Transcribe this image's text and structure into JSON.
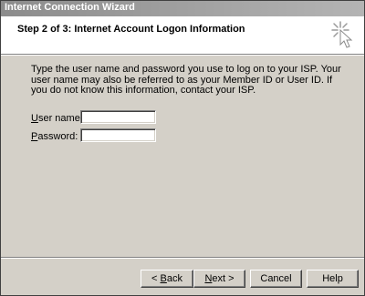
{
  "window": {
    "title": "Internet Connection Wizard"
  },
  "header": {
    "step_title": "Step 2 of 3: Internet Account Logon Information",
    "icon": "wizard-wand-icon"
  },
  "body": {
    "description": "Type the user name and password you use to log on to your ISP. Your user name may also be referred to as your Member ID or User ID. If you do not know this information, contact your ISP.",
    "username": {
      "label_mnemonic": "U",
      "label_rest": "ser name:",
      "value": ""
    },
    "password": {
      "label_mnemonic": "P",
      "label_rest": "assword:",
      "value": ""
    }
  },
  "buttons": {
    "back": {
      "prefix": "< ",
      "mnemonic": "B",
      "rest": "ack"
    },
    "next": {
      "mnemonic": "N",
      "rest": "ext >"
    },
    "cancel": {
      "label": "Cancel"
    },
    "help": {
      "label": "Help"
    }
  }
}
